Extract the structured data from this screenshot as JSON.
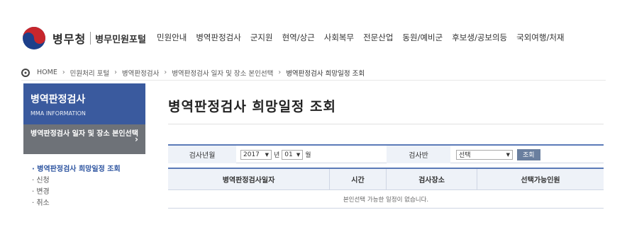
{
  "brand": {
    "title": "병무청",
    "subtitle": "병무민원포털"
  },
  "gnb": [
    "민원안내",
    "병역판정검사",
    "군지원",
    "현역/상근",
    "사회복무",
    "전문산업",
    "동원/예비군",
    "후보생/공보의등",
    "국외여행/처재"
  ],
  "breadcrumb": [
    "HOME",
    "민원처리 포털",
    "병역판정검사",
    "병역판정검사 일자 및 장소 본인선택",
    "병역판정검사 희망일정 조회"
  ],
  "lnb": {
    "title": "병역판정검사",
    "subtitle": "MMA INFORMATION",
    "selected": "병역판정검사 일자 및 장소 본인선택",
    "selected_arrow": "›",
    "items": [
      "병역판정검사 희망일정 조회",
      "신청",
      "변경",
      "취소"
    ]
  },
  "content": {
    "page_title": "병역판정검사 희망일정 조회",
    "filter": {
      "year_month_label": "검사년월",
      "year_value": "2017",
      "year_unit": "년",
      "month_value": "01",
      "month_unit": "월",
      "group_label": "검사반",
      "group_value": "선택",
      "search_button": "조회"
    },
    "table": {
      "headers": [
        "병역판정검사일자",
        "시간",
        "검사장소",
        "선택가능인원"
      ],
      "empty_message": "본인선택 가능한 일정이 없습니다."
    }
  },
  "colors": {
    "primary": "#3a5a9e",
    "nav_selected": "#6e7278",
    "table_border": "#5b7ab8"
  }
}
